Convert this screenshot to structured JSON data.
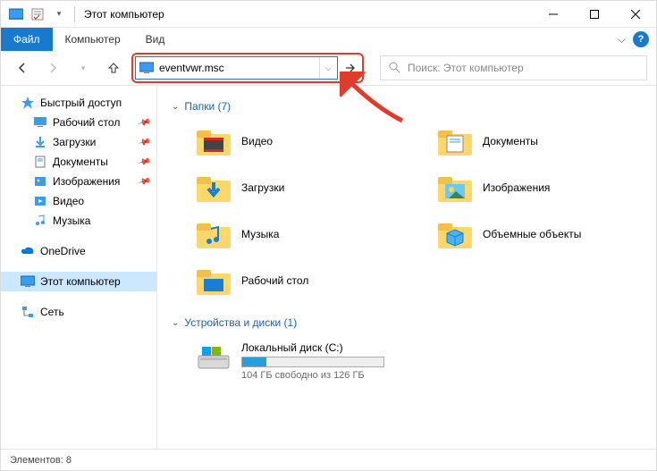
{
  "window": {
    "title": "Этот компьютер"
  },
  "menubar": {
    "file": "Файл",
    "computer": "Компьютер",
    "view": "Вид"
  },
  "address": {
    "value": "eventvwr.msc"
  },
  "search": {
    "placeholder": "Поиск: Этот компьютер"
  },
  "sidebar": {
    "quickaccess": "Быстрый доступ",
    "desktop": "Рабочий стол",
    "downloads": "Загрузки",
    "documents": "Документы",
    "pictures": "Изображения",
    "videos": "Видео",
    "music": "Музыка",
    "onedrive": "OneDrive",
    "thispc": "Этот компьютер",
    "network": "Сеть"
  },
  "groups": {
    "folders_header": "Папки (7)",
    "drives_header": "Устройства и диски (1)"
  },
  "folders": {
    "videos": "Видео",
    "documents": "Документы",
    "downloads": "Загрузки",
    "pictures": "Изображения",
    "music": "Музыка",
    "objects3d": "Объемные объекты",
    "desktop": "Рабочий стол"
  },
  "drive": {
    "name": "Локальный диск (C:)",
    "sub": "104 ГБ свободно из 126 ГБ",
    "fill_percent": 17
  },
  "statusbar": {
    "text": "Элементов: 8"
  }
}
